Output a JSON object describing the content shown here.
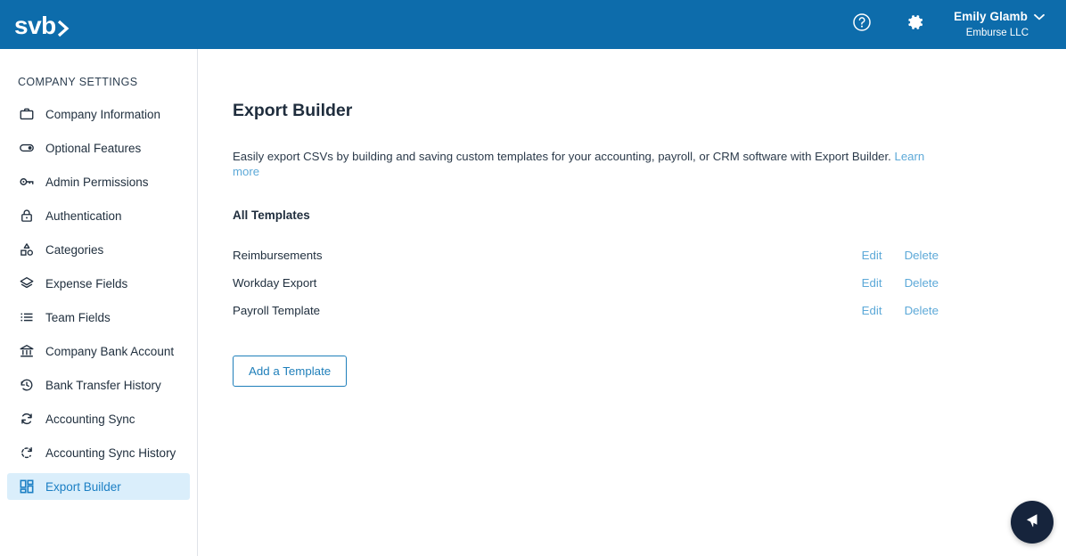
{
  "header": {
    "logo_text": "svb",
    "logo_icon": "chevron-right-icon",
    "help_icon": "question-circle-icon",
    "settings_icon": "gear-icon",
    "user_name": "Emily Glamb",
    "user_org": "Emburse LLC",
    "chevron_icon": "chevron-down-icon",
    "brand_color": "#0d6cab"
  },
  "sidebar": {
    "title": "COMPANY SETTINGS",
    "active_bg": "#daeefb",
    "active_color": "#1b7fc4",
    "items": [
      {
        "label": "Company Information",
        "icon": "briefcase-icon",
        "active": false
      },
      {
        "label": "Optional Features",
        "icon": "toggle-on-icon",
        "active": false
      },
      {
        "label": "Admin Permissions",
        "icon": "key-icon",
        "active": false
      },
      {
        "label": "Authentication",
        "icon": "lock-icon",
        "active": false
      },
      {
        "label": "Categories",
        "icon": "shapes-icon",
        "active": false
      },
      {
        "label": "Expense Fields",
        "icon": "layers-icon",
        "active": false
      },
      {
        "label": "Team Fields",
        "icon": "list-icon",
        "active": false
      },
      {
        "label": "Company Bank Account",
        "icon": "bank-icon",
        "active": false
      },
      {
        "label": "Bank Transfer History",
        "icon": "clock-history-icon",
        "active": false
      },
      {
        "label": "Accounting Sync",
        "icon": "sync-icon",
        "active": false
      },
      {
        "label": "Accounting Sync History",
        "icon": "sync-history-icon",
        "active": false
      },
      {
        "label": "Export Builder",
        "icon": "grid-blocks-icon",
        "active": true
      }
    ]
  },
  "main": {
    "page_title": "Export Builder",
    "description": "Easily export CSVs by building and saving custom templates for your accounting, payroll, or CRM software with Export Builder.",
    "learn_more_label": "Learn more",
    "section_title": "All Templates",
    "link_color": "#5da9d8",
    "templates": [
      {
        "name": "Reimbursements",
        "edit_label": "Edit",
        "delete_label": "Delete"
      },
      {
        "name": "Workday Export",
        "edit_label": "Edit",
        "delete_label": "Delete"
      },
      {
        "name": "Payroll Template",
        "edit_label": "Edit",
        "delete_label": "Delete"
      }
    ],
    "add_template_label": "Add a Template"
  },
  "chat_widget": {
    "icon": "paper-plane-icon",
    "color": "#16243c"
  }
}
